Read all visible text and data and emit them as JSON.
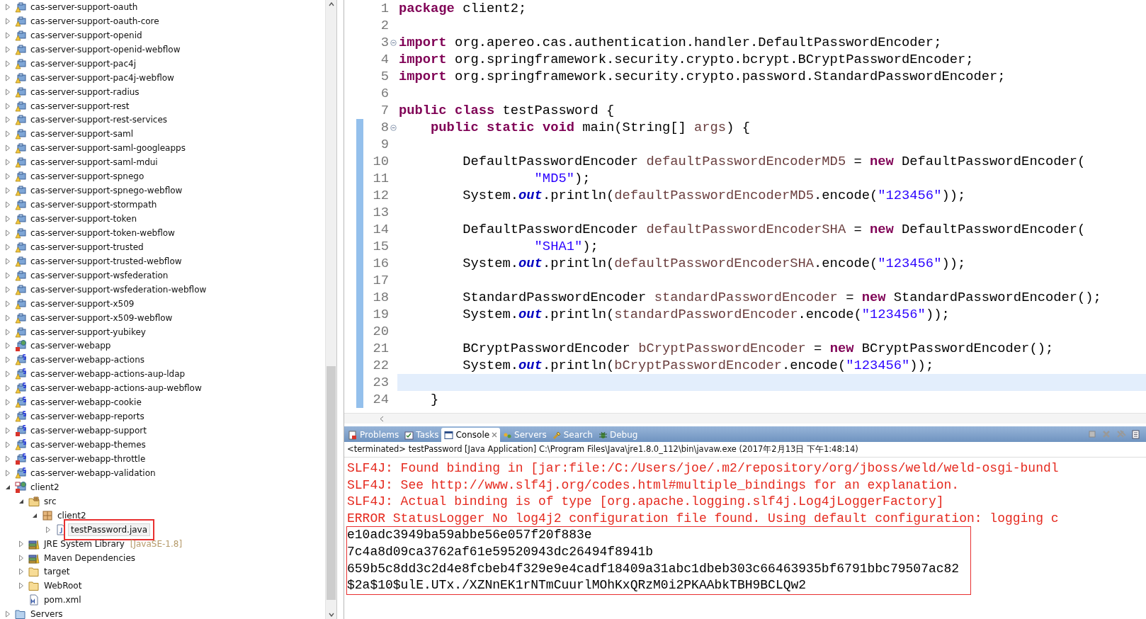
{
  "project_explorer": {
    "tree": [
      {
        "label": "cas-server-support-oauth",
        "kind": "project",
        "error": false,
        "expanded": false,
        "selected": false
      },
      {
        "label": "cas-server-support-oauth-core",
        "kind": "project",
        "error": false,
        "expanded": false,
        "selected": false
      },
      {
        "label": "cas-server-support-openid",
        "kind": "project",
        "error": false,
        "expanded": false,
        "selected": false
      },
      {
        "label": "cas-server-support-openid-webflow",
        "kind": "project",
        "error": false,
        "expanded": false,
        "selected": false
      },
      {
        "label": "cas-server-support-pac4j",
        "kind": "project",
        "error": false,
        "expanded": false,
        "selected": false
      },
      {
        "label": "cas-server-support-pac4j-webflow",
        "kind": "project",
        "error": false,
        "expanded": false,
        "selected": false
      },
      {
        "label": "cas-server-support-radius",
        "kind": "project",
        "error": false,
        "expanded": false,
        "selected": false
      },
      {
        "label": "cas-server-support-rest",
        "kind": "project",
        "error": false,
        "expanded": false,
        "selected": false
      },
      {
        "label": "cas-server-support-rest-services",
        "kind": "project",
        "error": false,
        "expanded": false,
        "selected": false
      },
      {
        "label": "cas-server-support-saml",
        "kind": "project",
        "error": false,
        "expanded": false,
        "selected": false
      },
      {
        "label": "cas-server-support-saml-googleapps",
        "kind": "project",
        "error": false,
        "expanded": false,
        "selected": false
      },
      {
        "label": "cas-server-support-saml-mdui",
        "kind": "project",
        "error": false,
        "expanded": false,
        "selected": false
      },
      {
        "label": "cas-server-support-spnego",
        "kind": "project",
        "error": false,
        "expanded": false,
        "selected": false
      },
      {
        "label": "cas-server-support-spnego-webflow",
        "kind": "project",
        "error": false,
        "expanded": false,
        "selected": false
      },
      {
        "label": "cas-server-support-stormpath",
        "kind": "project",
        "error": false,
        "expanded": false,
        "selected": false
      },
      {
        "label": "cas-server-support-token",
        "kind": "project",
        "error": false,
        "expanded": false,
        "selected": false
      },
      {
        "label": "cas-server-support-token-webflow",
        "kind": "project",
        "error": false,
        "expanded": false,
        "selected": false
      },
      {
        "label": "cas-server-support-trusted",
        "kind": "project",
        "error": false,
        "expanded": false,
        "selected": false
      },
      {
        "label": "cas-server-support-trusted-webflow",
        "kind": "project",
        "error": false,
        "expanded": false,
        "selected": false
      },
      {
        "label": "cas-server-support-wsfederation",
        "kind": "project",
        "error": false,
        "expanded": false,
        "selected": false
      },
      {
        "label": "cas-server-support-wsfederation-webflow",
        "kind": "project",
        "error": false,
        "expanded": false,
        "selected": false
      },
      {
        "label": "cas-server-support-x509",
        "kind": "project",
        "error": false,
        "expanded": false,
        "selected": false
      },
      {
        "label": "cas-server-support-x509-webflow",
        "kind": "project",
        "error": false,
        "expanded": false,
        "selected": false
      },
      {
        "label": "cas-server-support-yubikey",
        "kind": "project",
        "error": false,
        "expanded": false,
        "selected": false
      },
      {
        "label": "cas-server-webapp",
        "kind": "web-project",
        "error": true,
        "expanded": false,
        "selected": false
      },
      {
        "label": "cas-server-webapp-actions",
        "kind": "spring-project",
        "error": false,
        "expanded": false,
        "selected": false
      },
      {
        "label": "cas-server-webapp-actions-aup-ldap",
        "kind": "spring-project",
        "error": false,
        "expanded": false,
        "selected": false
      },
      {
        "label": "cas-server-webapp-actions-aup-webflow",
        "kind": "spring-project",
        "error": false,
        "expanded": false,
        "selected": false
      },
      {
        "label": "cas-server-webapp-cookie",
        "kind": "spring-project",
        "error": false,
        "expanded": false,
        "selected": false
      },
      {
        "label": "cas-server-webapp-reports",
        "kind": "spring-project",
        "error": false,
        "expanded": false,
        "selected": false
      },
      {
        "label": "cas-server-webapp-support",
        "kind": "spring-project",
        "error": true,
        "expanded": false,
        "selected": false
      },
      {
        "label": "cas-server-webapp-themes",
        "kind": "spring-project",
        "error": false,
        "expanded": false,
        "selected": false
      },
      {
        "label": "cas-server-webapp-throttle",
        "kind": "spring-project",
        "error": true,
        "expanded": false,
        "selected": false
      },
      {
        "label": "cas-server-webapp-validation",
        "kind": "spring-project",
        "error": false,
        "expanded": false,
        "selected": false
      },
      {
        "label": "client2",
        "kind": "maven-project",
        "error": true,
        "expanded": true,
        "selected": false,
        "children": [
          {
            "label": "src",
            "kind": "source-folder",
            "expanded": true,
            "selected": false,
            "children": [
              {
                "label": "client2",
                "kind": "package",
                "expanded": true,
                "selected": false,
                "children": [
                  {
                    "label": "testPassword.java",
                    "kind": "java-file",
                    "expanded": false,
                    "selected": true,
                    "annotated": true
                  }
                ]
              }
            ]
          },
          {
            "label": "JRE System Library",
            "suffix": "[JavaSE-1.8]",
            "kind": "library",
            "expanded": false,
            "selected": false
          },
          {
            "label": "Maven Dependencies",
            "kind": "library",
            "expanded": false,
            "selected": false
          },
          {
            "label": "target",
            "kind": "folder",
            "expanded": false,
            "selected": false
          },
          {
            "label": "WebRoot",
            "kind": "folder",
            "expanded": false,
            "selected": false
          },
          {
            "label": "pom.xml",
            "kind": "pom-file",
            "selected": false
          }
        ]
      },
      {
        "label": "Servers",
        "kind": "servers-folder",
        "expanded": false,
        "selected": false
      }
    ]
  },
  "editor": {
    "lines": [
      {
        "number": "1",
        "collapsible": false,
        "highlighted": false,
        "selected": false,
        "tokens": [
          {
            "kind": "keyword",
            "text": "package"
          },
          {
            "kind": "plain",
            "text": " client2;"
          }
        ]
      },
      {
        "number": "2",
        "collapsible": false,
        "highlighted": false,
        "selected": false
      },
      {
        "number": "3",
        "collapsible": true,
        "highlighted": false,
        "selected": false,
        "tokens": [
          {
            "kind": "keyword",
            "text": "import"
          },
          {
            "kind": "plain",
            "text": " org.apereo.cas.authentication.handler.DefaultPasswordEncoder;"
          }
        ]
      },
      {
        "number": "4",
        "collapsible": false,
        "highlighted": false,
        "selected": false,
        "tokens": [
          {
            "kind": "keyword",
            "text": "import"
          },
          {
            "kind": "plain",
            "text": " org.springframework.security.crypto.bcrypt.BCryptPasswordEncoder;"
          }
        ]
      },
      {
        "number": "5",
        "collapsible": false,
        "highlighted": false,
        "selected": false,
        "tokens": [
          {
            "kind": "keyword",
            "text": "import"
          },
          {
            "kind": "plain",
            "text": " org.springframework.security.crypto.password.StandardPasswordEncoder;"
          }
        ]
      },
      {
        "number": "6",
        "collapsible": false,
        "highlighted": false,
        "selected": false
      },
      {
        "number": "7",
        "collapsible": false,
        "highlighted": false,
        "selected": false,
        "tokens": [
          {
            "kind": "keyword",
            "text": "public"
          },
          {
            "kind": "keyword",
            "text": " class"
          },
          {
            "kind": "plain",
            "text": " testPassword {"
          }
        ]
      },
      {
        "number": "8",
        "collapsible": true,
        "highlighted": true,
        "selected": false,
        "tokens": [
          {
            "kind": "keyword",
            "text": "    public"
          },
          {
            "kind": "keyword",
            "text": " static"
          },
          {
            "kind": "keyword",
            "text": " void"
          },
          {
            "kind": "plain",
            "text": " main(String[] "
          },
          {
            "kind": "variable",
            "text": "args"
          },
          {
            "kind": "plain",
            "text": ") {"
          }
        ]
      },
      {
        "number": "9",
        "collapsible": false,
        "highlighted": true,
        "selected": false
      },
      {
        "number": "10",
        "collapsible": false,
        "highlighted": true,
        "selected": false,
        "tokens": [
          {
            "kind": "plain",
            "text": "        DefaultPasswordEncoder "
          },
          {
            "kind": "variable",
            "text": "defaultPasswordEncoderMD5"
          },
          {
            "kind": "plain",
            "text": " = "
          },
          {
            "kind": "keyword",
            "text": "new"
          },
          {
            "kind": "plain",
            "text": " DefaultPasswordEncoder("
          }
        ]
      },
      {
        "number": "11",
        "collapsible": false,
        "highlighted": true,
        "selected": false,
        "tokens": [
          {
            "kind": "string",
            "text": "                 \"MD5\""
          },
          {
            "kind": "plain",
            "text": ");"
          }
        ]
      },
      {
        "number": "12",
        "collapsible": false,
        "highlighted": true,
        "selected": false,
        "tokens": [
          {
            "kind": "plain",
            "text": "        System."
          },
          {
            "kind": "static",
            "text": "out"
          },
          {
            "kind": "plain",
            "text": ".println("
          },
          {
            "kind": "variable",
            "text": "defaultPasswordEncoderMD5"
          },
          {
            "kind": "plain",
            "text": ".encode("
          },
          {
            "kind": "string",
            "text": "\"123456\""
          },
          {
            "kind": "plain",
            "text": "));"
          }
        ]
      },
      {
        "number": "13",
        "collapsible": false,
        "highlighted": true,
        "selected": false
      },
      {
        "number": "14",
        "collapsible": false,
        "highlighted": true,
        "selected": false,
        "tokens": [
          {
            "kind": "plain",
            "text": "        DefaultPasswordEncoder "
          },
          {
            "kind": "variable",
            "text": "defaultPasswordEncoderSHA"
          },
          {
            "kind": "plain",
            "text": " = "
          },
          {
            "kind": "keyword",
            "text": "new"
          },
          {
            "kind": "plain",
            "text": " DefaultPasswordEncoder("
          }
        ]
      },
      {
        "number": "15",
        "collapsible": false,
        "highlighted": true,
        "selected": false,
        "tokens": [
          {
            "kind": "string",
            "text": "                 \"SHA1\""
          },
          {
            "kind": "plain",
            "text": ");"
          }
        ]
      },
      {
        "number": "16",
        "collapsible": false,
        "highlighted": true,
        "selected": false,
        "tokens": [
          {
            "kind": "plain",
            "text": "        System."
          },
          {
            "kind": "static",
            "text": "out"
          },
          {
            "kind": "plain",
            "text": ".println("
          },
          {
            "kind": "variable",
            "text": "defaultPasswordEncoderSHA"
          },
          {
            "kind": "plain",
            "text": ".encode("
          },
          {
            "kind": "string",
            "text": "\"123456\""
          },
          {
            "kind": "plain",
            "text": "));"
          }
        ]
      },
      {
        "number": "17",
        "collapsible": false,
        "highlighted": true,
        "selected": false
      },
      {
        "number": "18",
        "collapsible": false,
        "highlighted": true,
        "selected": false,
        "tokens": [
          {
            "kind": "plain",
            "text": "        StandardPasswordEncoder "
          },
          {
            "kind": "variable",
            "text": "standardPasswordEncoder"
          },
          {
            "kind": "plain",
            "text": " = "
          },
          {
            "kind": "keyword",
            "text": "new"
          },
          {
            "kind": "plain",
            "text": " StandardPasswordEncoder();"
          }
        ]
      },
      {
        "number": "19",
        "collapsible": false,
        "highlighted": true,
        "selected": false,
        "tokens": [
          {
            "kind": "plain",
            "text": "        System."
          },
          {
            "kind": "static",
            "text": "out"
          },
          {
            "kind": "plain",
            "text": ".println("
          },
          {
            "kind": "variable",
            "text": "standardPasswordEncoder"
          },
          {
            "kind": "plain",
            "text": ".encode("
          },
          {
            "kind": "string",
            "text": "\"123456\""
          },
          {
            "kind": "plain",
            "text": "));"
          }
        ]
      },
      {
        "number": "20",
        "collapsible": false,
        "highlighted": true,
        "selected": false
      },
      {
        "number": "21",
        "collapsible": false,
        "highlighted": true,
        "selected": false,
        "tokens": [
          {
            "kind": "plain",
            "text": "        BCryptPasswordEncoder "
          },
          {
            "kind": "variable",
            "text": "bCryptPasswordEncoder"
          },
          {
            "kind": "plain",
            "text": " = "
          },
          {
            "kind": "keyword",
            "text": "new"
          },
          {
            "kind": "plain",
            "text": " BCryptPasswordEncoder();"
          }
        ]
      },
      {
        "number": "22",
        "collapsible": false,
        "highlighted": true,
        "selected": false,
        "tokens": [
          {
            "kind": "plain",
            "text": "        System."
          },
          {
            "kind": "static",
            "text": "out"
          },
          {
            "kind": "plain",
            "text": ".println("
          },
          {
            "kind": "variable",
            "text": "bCryptPasswordEncoder"
          },
          {
            "kind": "plain",
            "text": ".encode("
          },
          {
            "kind": "string",
            "text": "\"123456\""
          },
          {
            "kind": "plain",
            "text": "));"
          }
        ]
      },
      {
        "number": "23",
        "collapsible": false,
        "highlighted": true,
        "selected": true
      },
      {
        "number": "24",
        "collapsible": false,
        "highlighted": true,
        "selected": false,
        "tokens": [
          {
            "kind": "plain",
            "text": "    }"
          }
        ]
      }
    ]
  },
  "console_view": {
    "tabs": [
      {
        "label": "Problems",
        "selected": false
      },
      {
        "label": "Tasks",
        "selected": false
      },
      {
        "label": "Console",
        "selected": true
      },
      {
        "label": "Servers",
        "selected": false
      },
      {
        "label": "Search",
        "selected": false
      },
      {
        "label": "Debug",
        "selected": false
      }
    ],
    "status": "<terminated> testPassword [Java Application] C:\\Program Files\\Java\\jre1.8.0_112\\bin\\javaw.exe (2017年2月13日 下午1:48:14)",
    "lines": [
      {
        "kind": "stderr",
        "text": "SLF4J: Found binding in [jar:file:/C:/Users/joe/.m2/repository/org/jboss/weld/weld-osgi-bundl"
      },
      {
        "kind": "stderr",
        "text": "SLF4J: See http://www.slf4j.org/codes.html#multiple_bindings for an explanation."
      },
      {
        "kind": "stderr",
        "text": "SLF4J: Actual binding is of type [org.apache.logging.slf4j.Log4jLoggerFactory]"
      },
      {
        "kind": "stderr",
        "text": "ERROR StatusLogger No log4j2 configuration file found. Using default configuration: logging c"
      },
      {
        "kind": "stdout",
        "text": "e10adc3949ba59abbe56e057f20f883e"
      },
      {
        "kind": "stdout",
        "text": "7c4a8d09ca3762af61e59520943dc26494f8941b"
      },
      {
        "kind": "stdout",
        "text": "659b5c8dd3c2d4e8fcbeb4f329e9e4cadf18409a31abc1dbeb303c66463935bf6791bbc79507ac82"
      },
      {
        "kind": "stdout",
        "text": "$2a$10$ulE.UTx./XZNnEK1rNTmCuurlMOhKxQRzM0i2PKAAbkTBH9BCLQw2"
      }
    ]
  }
}
